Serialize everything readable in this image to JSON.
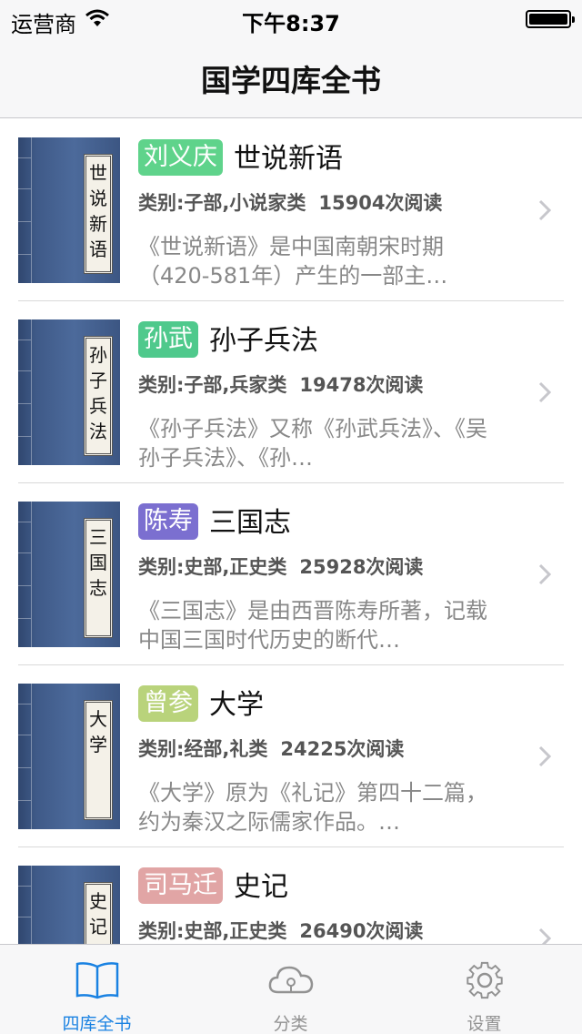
{
  "status_bar": {
    "carrier": "运营商",
    "time": "下午8:37"
  },
  "nav": {
    "title": "国学四库全书"
  },
  "books": [
    {
      "author": "刘义庆",
      "author_color": "#5fd38b",
      "title": "世说新语",
      "category": "类别:子部,小说家类",
      "reads": "15904次阅读",
      "desc": "《世说新语》是中国南朝宋时期（420-581年）产生的一部主…",
      "cover_text": "世说新语"
    },
    {
      "author": "孙武",
      "author_color": "#4fc98c",
      "title": "孙子兵法",
      "category": "类别:子部,兵家类",
      "reads": "19478次阅读",
      "desc": "《孙子兵法》又称《孙武兵法》、《吴孙子兵法》、《孙…",
      "cover_text": "孙子兵法"
    },
    {
      "author": "陈寿",
      "author_color": "#7b6fd0",
      "title": "三国志",
      "category": "类别:史部,正史类",
      "reads": "25928次阅读",
      "desc": "《三国志》是由西晋陈寿所著，记载中国三国时代历史的断代…",
      "cover_text": "三国志"
    },
    {
      "author": "曾参",
      "author_color": "#b9d37b",
      "title": "大学",
      "category": "类别:经部,礼类",
      "reads": "24225次阅读",
      "desc": "《大学》原为《礼记》第四十二篇，约为秦汉之际儒家作品。…",
      "cover_text": "大学"
    },
    {
      "author": "司马迁",
      "author_color": "#e1a5a5",
      "title": "史记",
      "category": "类别:史部,正史类",
      "reads": "26490次阅读",
      "desc": "",
      "cover_text": "史记"
    }
  ],
  "tabs": [
    {
      "label": "四库全书",
      "icon": "book-icon",
      "active": true
    },
    {
      "label": "分类",
      "icon": "cloud-icon",
      "active": false
    },
    {
      "label": "设置",
      "icon": "gear-icon",
      "active": false
    }
  ],
  "colors": {
    "accent": "#1a82e2",
    "tab_inactive": "#929292"
  }
}
